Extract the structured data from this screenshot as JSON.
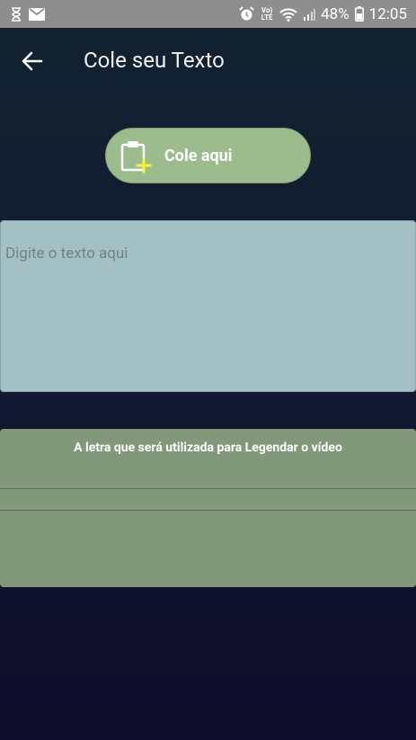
{
  "status_bar": {
    "battery": "48%",
    "time": "12:05",
    "volte": "Vo) LTE",
    "icons": [
      "hourglass-icon",
      "mail-icon",
      "alarm-icon",
      "volte-icon",
      "wifi-icon",
      "signal-icon",
      "battery-icon"
    ]
  },
  "app_bar": {
    "title": "Cole seu Texto",
    "back_icon": "arrow-left-icon"
  },
  "paste_button": {
    "label": "Cole aqui",
    "icon": "clipboard-plus-icon"
  },
  "text_input": {
    "placeholder": "Digite o texto aqui",
    "value": ""
  },
  "font_panel": {
    "title": "A letra que será utilizada para Legendar o vídeo"
  },
  "colors": {
    "status_bar": "#8e8e8e",
    "paste_button": "#9dbc8e",
    "text_box": "#a3c0c5",
    "font_panel": "#82987a",
    "plus_accent": "#f5f53a"
  }
}
